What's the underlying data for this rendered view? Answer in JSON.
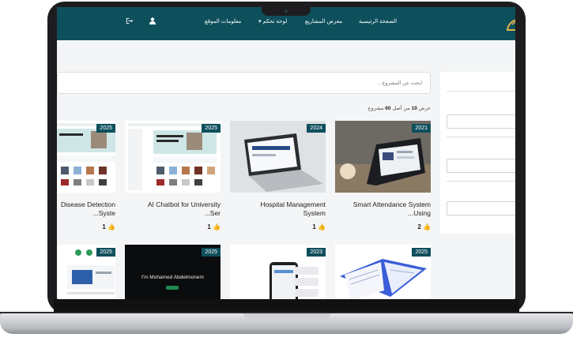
{
  "nav": {
    "home": "الصفحة الرئيسية",
    "projects": "معرض المشاريع",
    "dashboard": "لوحة تحكم",
    "site_info": "معلومات الموقع",
    "user_icon": "user-icon",
    "logout_icon": "logout-icon",
    "caret": "▾"
  },
  "search": {
    "placeholder": "ابحث عن المشروع .."
  },
  "results": {
    "prefix": "عرض",
    "shown": "10",
    "middle": "من أصل",
    "total": "60",
    "suffix": "مشروع"
  },
  "cards_row1": [
    {
      "year": "2021",
      "title_line1": "Smart Attendance System",
      "title_line2": "...Using",
      "likes": "2"
    },
    {
      "year": "2024",
      "title_line1": "Hospital Management",
      "title_line2": "System",
      "likes": "1"
    },
    {
      "year": "2025",
      "title_line1": "AI Chatbot for University",
      "title_line2": "...Ser",
      "likes": "1"
    },
    {
      "year": "2025",
      "title_line1": "Disease Detection",
      "title_line2": "...Syste",
      "likes": "1"
    }
  ],
  "cards_row2": [
    {
      "year": "2025"
    },
    {
      "year": "2023"
    },
    {
      "year": "2025",
      "hero_text": "I'm Mohamed Abdelmonem"
    },
    {
      "year": "2025"
    }
  ],
  "colors": {
    "brand": "#0e4f5c",
    "background": "#f4f5f6"
  }
}
